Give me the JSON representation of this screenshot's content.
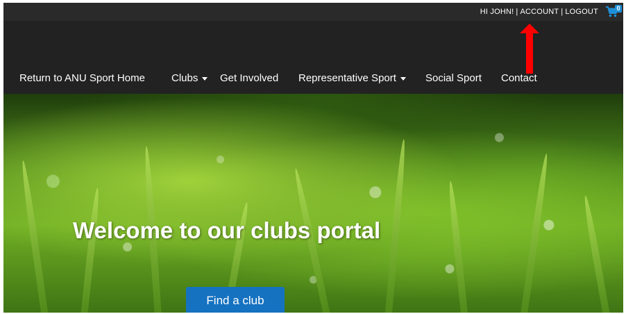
{
  "header": {
    "greeting": "HI JOHN!",
    "separator": "|",
    "account_label": "ACCOUNT",
    "logout_label": "LOGOUT",
    "cart_icon": "shopping-cart-icon",
    "cart_count": "0"
  },
  "annotation": {
    "icon": "red-arrow-up-icon",
    "color": "#ff0000"
  },
  "nav": {
    "items": [
      {
        "label": "Return to ANU Sport Home",
        "has_dropdown": false
      },
      {
        "label": "Clubs",
        "has_dropdown": true
      },
      {
        "label": "Get Involved",
        "has_dropdown": false
      },
      {
        "label": "Representative Sport",
        "has_dropdown": true
      },
      {
        "label": "Social Sport",
        "has_dropdown": false
      },
      {
        "label": "Contact",
        "has_dropdown": false
      }
    ]
  },
  "hero": {
    "title": "Welcome to our clubs portal",
    "button_label": "Find a club"
  },
  "colors": {
    "header_bg": "#222222",
    "button_bg": "#1572c0",
    "cart_icon": "#1e90d8"
  }
}
